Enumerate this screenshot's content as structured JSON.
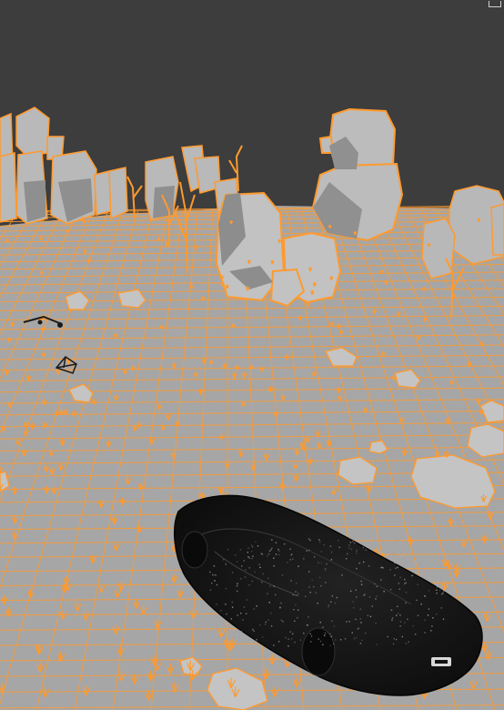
{
  "app": {
    "type": "3d-viewport",
    "mode": "wireframe-over-solid",
    "selection_color": "#ff9a2e"
  },
  "colors": {
    "background": "#3d3d3d",
    "ground": "#a8a8a8",
    "wire": "#ff9a2e",
    "rock": "#b8b8b8",
    "rock_shadow": "#8c8c8c",
    "car_body": "#161616",
    "car_wire": "#2a2a2a"
  },
  "viewport": {
    "corner_label": ""
  },
  "objects": [
    {
      "name": "ground-plane",
      "kind": "mesh",
      "selected": true
    },
    {
      "name": "rock-cluster",
      "kind": "mesh",
      "selected": true
    },
    {
      "name": "dry-grass-scatter",
      "kind": "mesh",
      "selected": true
    },
    {
      "name": "car",
      "kind": "mesh",
      "selected": false
    },
    {
      "name": "camera",
      "kind": "camera",
      "selected": false
    },
    {
      "name": "light",
      "kind": "light",
      "selected": false
    }
  ]
}
